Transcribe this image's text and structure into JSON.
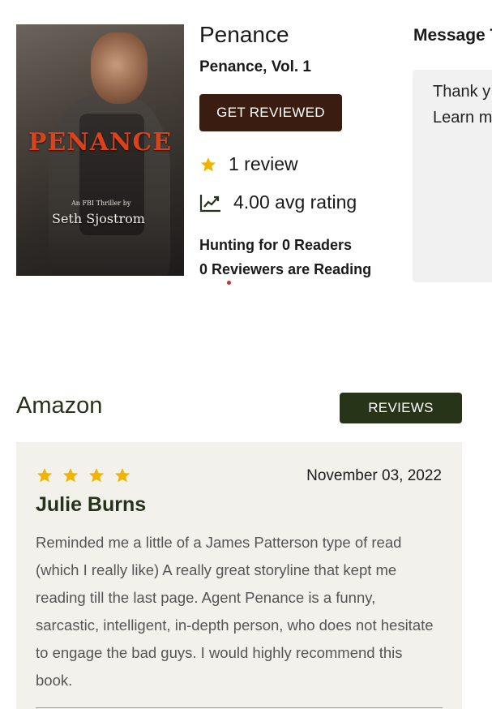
{
  "book": {
    "title": "Penance",
    "subtitle": "Penance, Vol. 1",
    "cover": {
      "title_text": "PENANCE",
      "tagline": "An FBI Thriller by",
      "author": "Seth Sjostrom"
    }
  },
  "actions": {
    "get_reviewed_label": "GET REVIEWED",
    "reviews_label": "REVIEWS"
  },
  "stats": {
    "review_count_text": "1 review",
    "avg_rating_text": "4.00 avg rating",
    "hunting_text": "Hunting for 0 Readers",
    "reviewers_reading_text": "0 Reviewers are Reading"
  },
  "message": {
    "heading": "Message T",
    "line1": "Thank y",
    "line2": "Learn m"
  },
  "amazon": {
    "heading": "Amazon",
    "review": {
      "stars": 4,
      "date": "November 03, 2022",
      "reviewer": "Julie Burns",
      "text": "Reminded me a little of a James Patterson type of read (which I really like) A really great storyline that kept me reading till the last page. Agent Penance is a funny, sarcastic, intelligent, in-depth person, who does not hesitate to engage the bad guys. I would highly recommend this book."
    }
  },
  "colors": {
    "get_reviewed_bg": "#3b1c10",
    "reviews_btn_bg": "#273418",
    "heading_green": "#26331a",
    "star_gold": "#f0b400",
    "review_card_bg": "#f3f1eb"
  },
  "icons": {
    "review_stat": "star-icon",
    "rating_stat": "trending-up-icon"
  }
}
